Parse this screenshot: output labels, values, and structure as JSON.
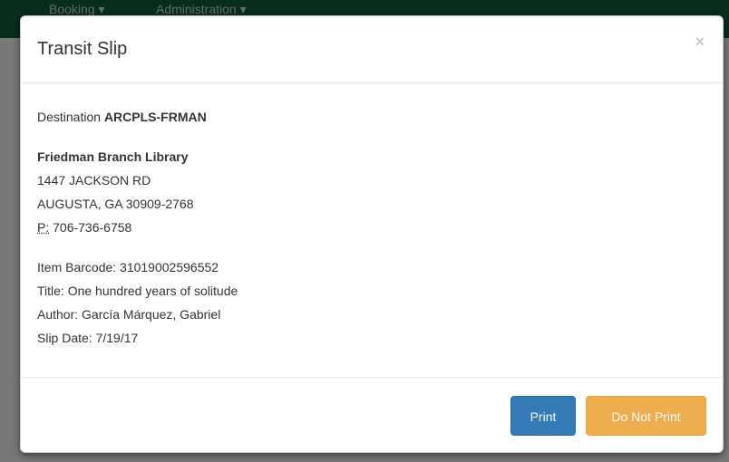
{
  "navbar": {
    "booking_label": "Booking ▾",
    "administration_label": "Administration ▾"
  },
  "modal": {
    "title": "Transit Slip",
    "close_symbol": "×",
    "destination_label": "Destination",
    "destination_code": "ARCPLS-FRMAN",
    "library": {
      "name": "Friedman Branch Library",
      "street": "1447 JACKSON RD",
      "city_state_zip": "AUGUSTA, GA 30909-2768",
      "phone_label": "P:",
      "phone": "706-736-6758"
    },
    "item": {
      "barcode_line": "Item Barcode: 31019002596552",
      "title_line": "Title: One hundred years of solitude",
      "author_line": "Author: García Márquez, Gabriel",
      "slip_date_line": "Slip Date: 7/19/17"
    },
    "buttons": {
      "print": "Print",
      "do_not_print": "Do Not Print"
    }
  },
  "colors": {
    "navbar": "#0f5a3a",
    "primary": "#337ab7",
    "warning": "#f0ad4e"
  }
}
